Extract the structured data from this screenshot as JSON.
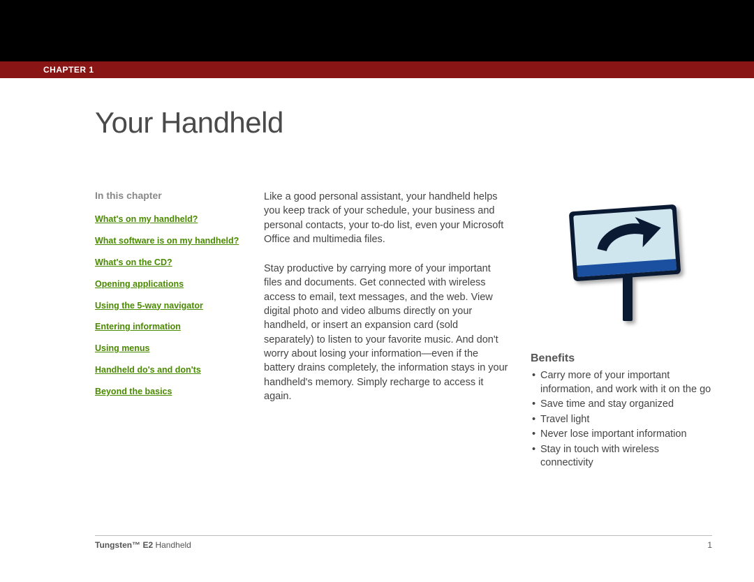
{
  "chapter_bar": "CHAPTER 1",
  "title": "Your Handheld",
  "sidebar": {
    "heading": "In this chapter",
    "links": [
      "What's on my handheld?",
      "What software is on my handheld?",
      "What's on the CD?",
      "Opening applications",
      "Using the 5-way navigator",
      "Entering information",
      "Using menus",
      "Handheld do's and don'ts",
      "Beyond the basics"
    ]
  },
  "body": {
    "p1": "Like a good personal assistant, your handheld helps you keep track of your schedule, your business and personal contacts, your to-do list, even your Microsoft Office and multimedia files.",
    "p2": "Stay productive by carrying more of your important files and documents. Get connected with wireless access to email, text messages, and the web. View digital photo and video albums directly on your handheld, or insert an expansion card (sold separately) to listen to your favorite music. And don't worry about losing your information—even if the battery drains completely, the information stays in your handheld's memory. Simply recharge to access it again."
  },
  "benefits": {
    "heading": "Benefits",
    "items": [
      "Carry more of your important information, and work with it on the go",
      "Save time and stay organized",
      "Travel light",
      "Never lose important information",
      "Stay in touch with wireless connectivity"
    ]
  },
  "footer": {
    "product_bold": "Tungsten™ E2",
    "product_rest": " Handheld",
    "page": "1"
  }
}
